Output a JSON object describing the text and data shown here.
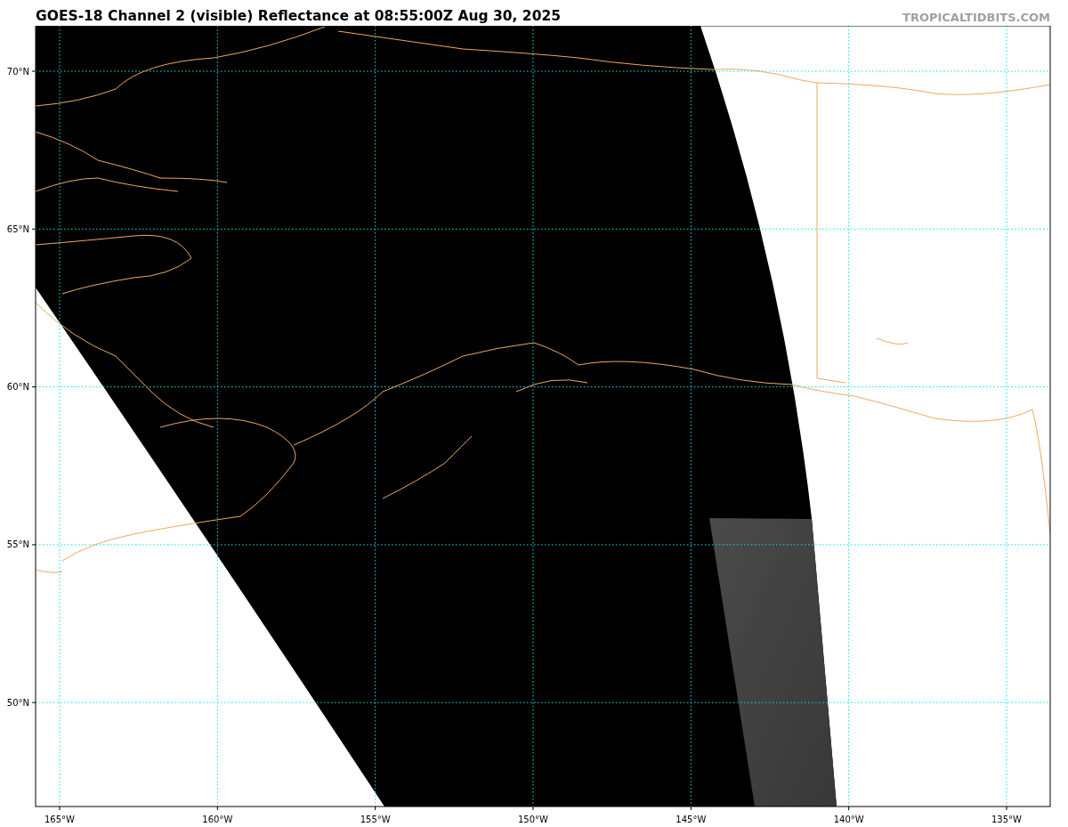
{
  "title": "GOES-18 Channel 2 (visible) Reflectance at 08:55:00Z Aug 30, 2025",
  "credit": "TROPICALTIDBITS.COM",
  "map": {
    "lat_labels": [
      "70°N",
      "65°N",
      "60°N",
      "55°N",
      "50°N"
    ],
    "lon_labels": [
      "165°W",
      "160°W",
      "155°W",
      "150°W",
      "145°W",
      "140°W",
      "135°W"
    ]
  }
}
